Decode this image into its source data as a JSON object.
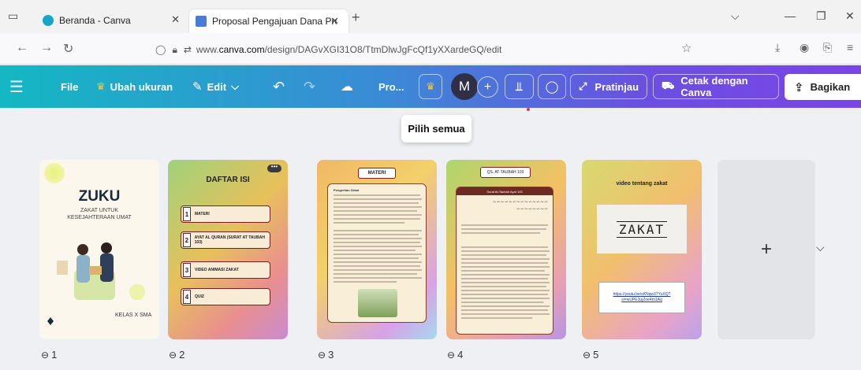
{
  "browser": {
    "tabs": [
      {
        "label": "Beranda - Canva"
      },
      {
        "label": "Proposal Pengajuan Dana Progr"
      }
    ],
    "url": {
      "prefix": "www.",
      "domain": "canva.com",
      "path": "/design/DAGvXGI31O8/TtmDlwJgFcQf1yXXardeGQ/edit"
    }
  },
  "toolbar": {
    "file": "File",
    "resize": "Ubah ukuran",
    "edit": "Edit",
    "project": "Pro...",
    "avatar_initial": "M",
    "preview": "Pratinjau",
    "print": "Cetak dengan Canva",
    "share": "Bagikan"
  },
  "tooltip": "Pilih semua",
  "pages": [
    {
      "number": "1",
      "title": "ZUKU",
      "subtitle": "ZAKAT UNTUK\nKESEJAHTERAAN UMAT",
      "footer": "KELAS X SMA"
    },
    {
      "number": "2",
      "title": "DAFTAR ISI",
      "items": [
        {
          "n": "1",
          "label": "MATERI"
        },
        {
          "n": "2",
          "label": "AYAT AL QURAN (SURAT AT TAUBAH 103)"
        },
        {
          "n": "3",
          "label": "VIDEO ANIMASI ZAKAT"
        },
        {
          "n": "4",
          "label": "QUIZ"
        }
      ]
    },
    {
      "number": "3",
      "header": "MATERI",
      "subheader": "Pengertian Zakat"
    },
    {
      "number": "4",
      "header": "QS. AT-TAUBAH 103",
      "subheader": "Surat At-Taubah Ayat 103"
    },
    {
      "number": "5",
      "title": "video tentang zakat",
      "image_text": "ZAKAT",
      "link": "https://youtu.be/sKNqw37YuXQ?si=wUPE3ujZoe4m1Aq"
    }
  ]
}
